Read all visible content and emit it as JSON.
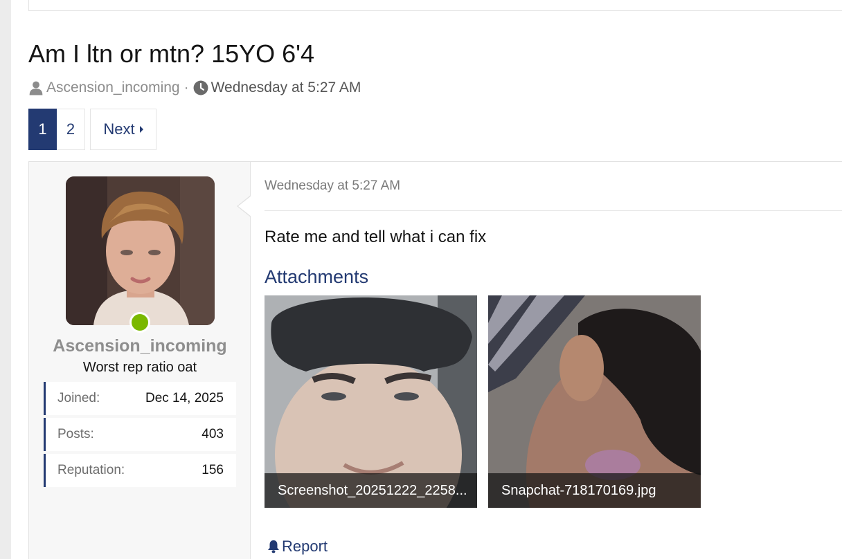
{
  "thread": {
    "title": "Am I ltn or mtn? 15YO 6'4",
    "author": "Ascension_incoming",
    "separator": "·",
    "date": "Wednesday at 5:27 AM"
  },
  "pagination": {
    "pages": [
      "1",
      "2"
    ],
    "current": "1",
    "next_label": "Next"
  },
  "post": {
    "user": {
      "username": "Ascension_incoming",
      "user_title": "Worst rep ratio oat",
      "online": true,
      "stats": [
        {
          "label": "Joined:",
          "value": "Dec 14, 2025"
        },
        {
          "label": "Posts:",
          "value": "403"
        },
        {
          "label": "Reputation:",
          "value": "156"
        }
      ]
    },
    "date": "Wednesday at 5:27 AM",
    "body": "Rate me and tell what i can fix",
    "attachments_heading": "Attachments",
    "attachments": [
      {
        "name": "Screenshot_20251222_2258..."
      },
      {
        "name": "Snapchat-718170169.jpg"
      }
    ],
    "report_label": "Report"
  },
  "icons": {
    "author": "user-icon",
    "date": "clock-icon",
    "next": "caret-right-icon",
    "report": "bell-icon"
  },
  "colors": {
    "accent": "#233a72",
    "online": "#7ab800",
    "muted": "#8c8c8c"
  }
}
